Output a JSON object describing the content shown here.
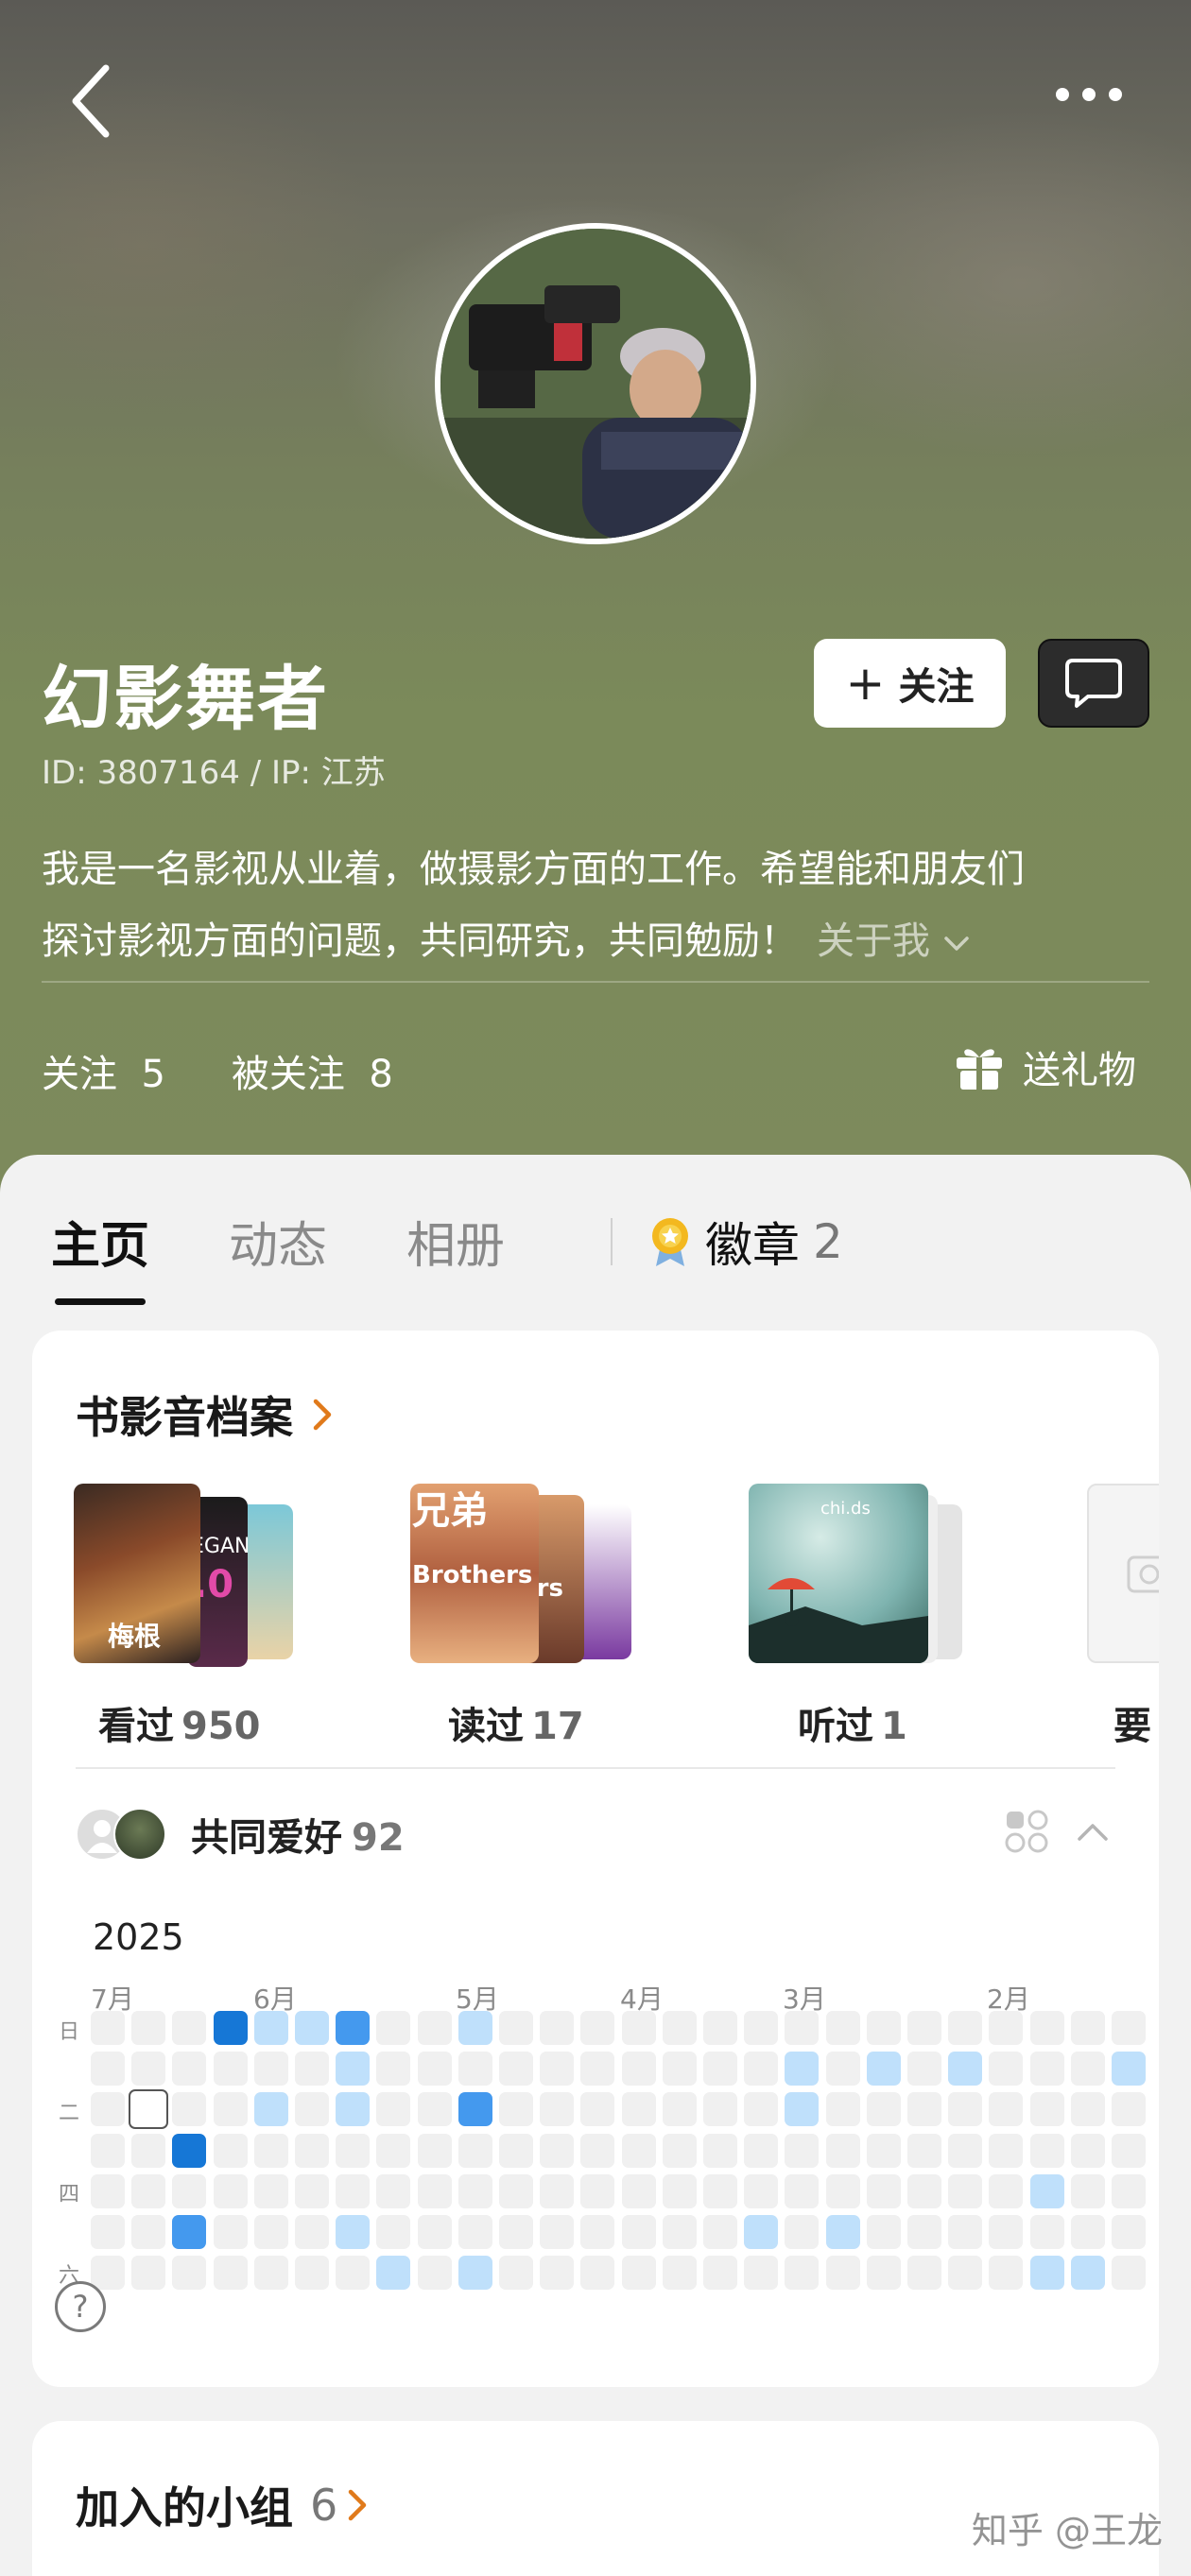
{
  "profile": {
    "name": "幻影舞者",
    "id_line": "ID: 3807164 / IP: 江苏",
    "bio_line1": "我是一名影视从业着，做摄影方面的工作。希望能和朋友们",
    "bio_line2": "探讨影视方面的问题，共同研究，共同勉励！",
    "bio_more": "关于我",
    "follow_label": "关注",
    "following_label": "关注",
    "following_count": "5",
    "followers_label": "被关注",
    "followers_count": "8",
    "gift_label": "送礼物"
  },
  "tabs": [
    {
      "label": "主页",
      "active": true
    },
    {
      "label": "动态",
      "active": false
    },
    {
      "label": "相册",
      "active": false
    }
  ],
  "badge_tab": {
    "label": "徽章",
    "count": "2"
  },
  "archive": {
    "title": "书影音档案",
    "shelves": [
      {
        "label": "看过",
        "count": "950",
        "cover_text": "梅根",
        "cover_text2": "EGAN",
        "cover_text3": ".0"
      },
      {
        "label": "读过",
        "count": "17",
        "cover_text": "兄弟",
        "cover_text2": "Brothers",
        "cover_text3": "ers"
      },
      {
        "label": "听过",
        "count": "1",
        "cover_text": "chi.ds"
      },
      {
        "label": "要",
        "count": ""
      }
    ]
  },
  "common": {
    "label": "共同爱好",
    "count": "92"
  },
  "heatmap": {
    "year": "2025",
    "months": [
      "7月",
      "6月",
      "5月",
      "4月",
      "3月",
      "2月"
    ],
    "day_labels": [
      "日",
      "二",
      "四",
      "六"
    ],
    "colors": {
      "empty": "#f0f0f0",
      "light": "#bfe0fb",
      "mid": "#4499ee",
      "dark": "#1677d6"
    }
  },
  "groups": {
    "title": "加入的小组",
    "count": "6"
  },
  "watermark": "知乎 @王龙"
}
